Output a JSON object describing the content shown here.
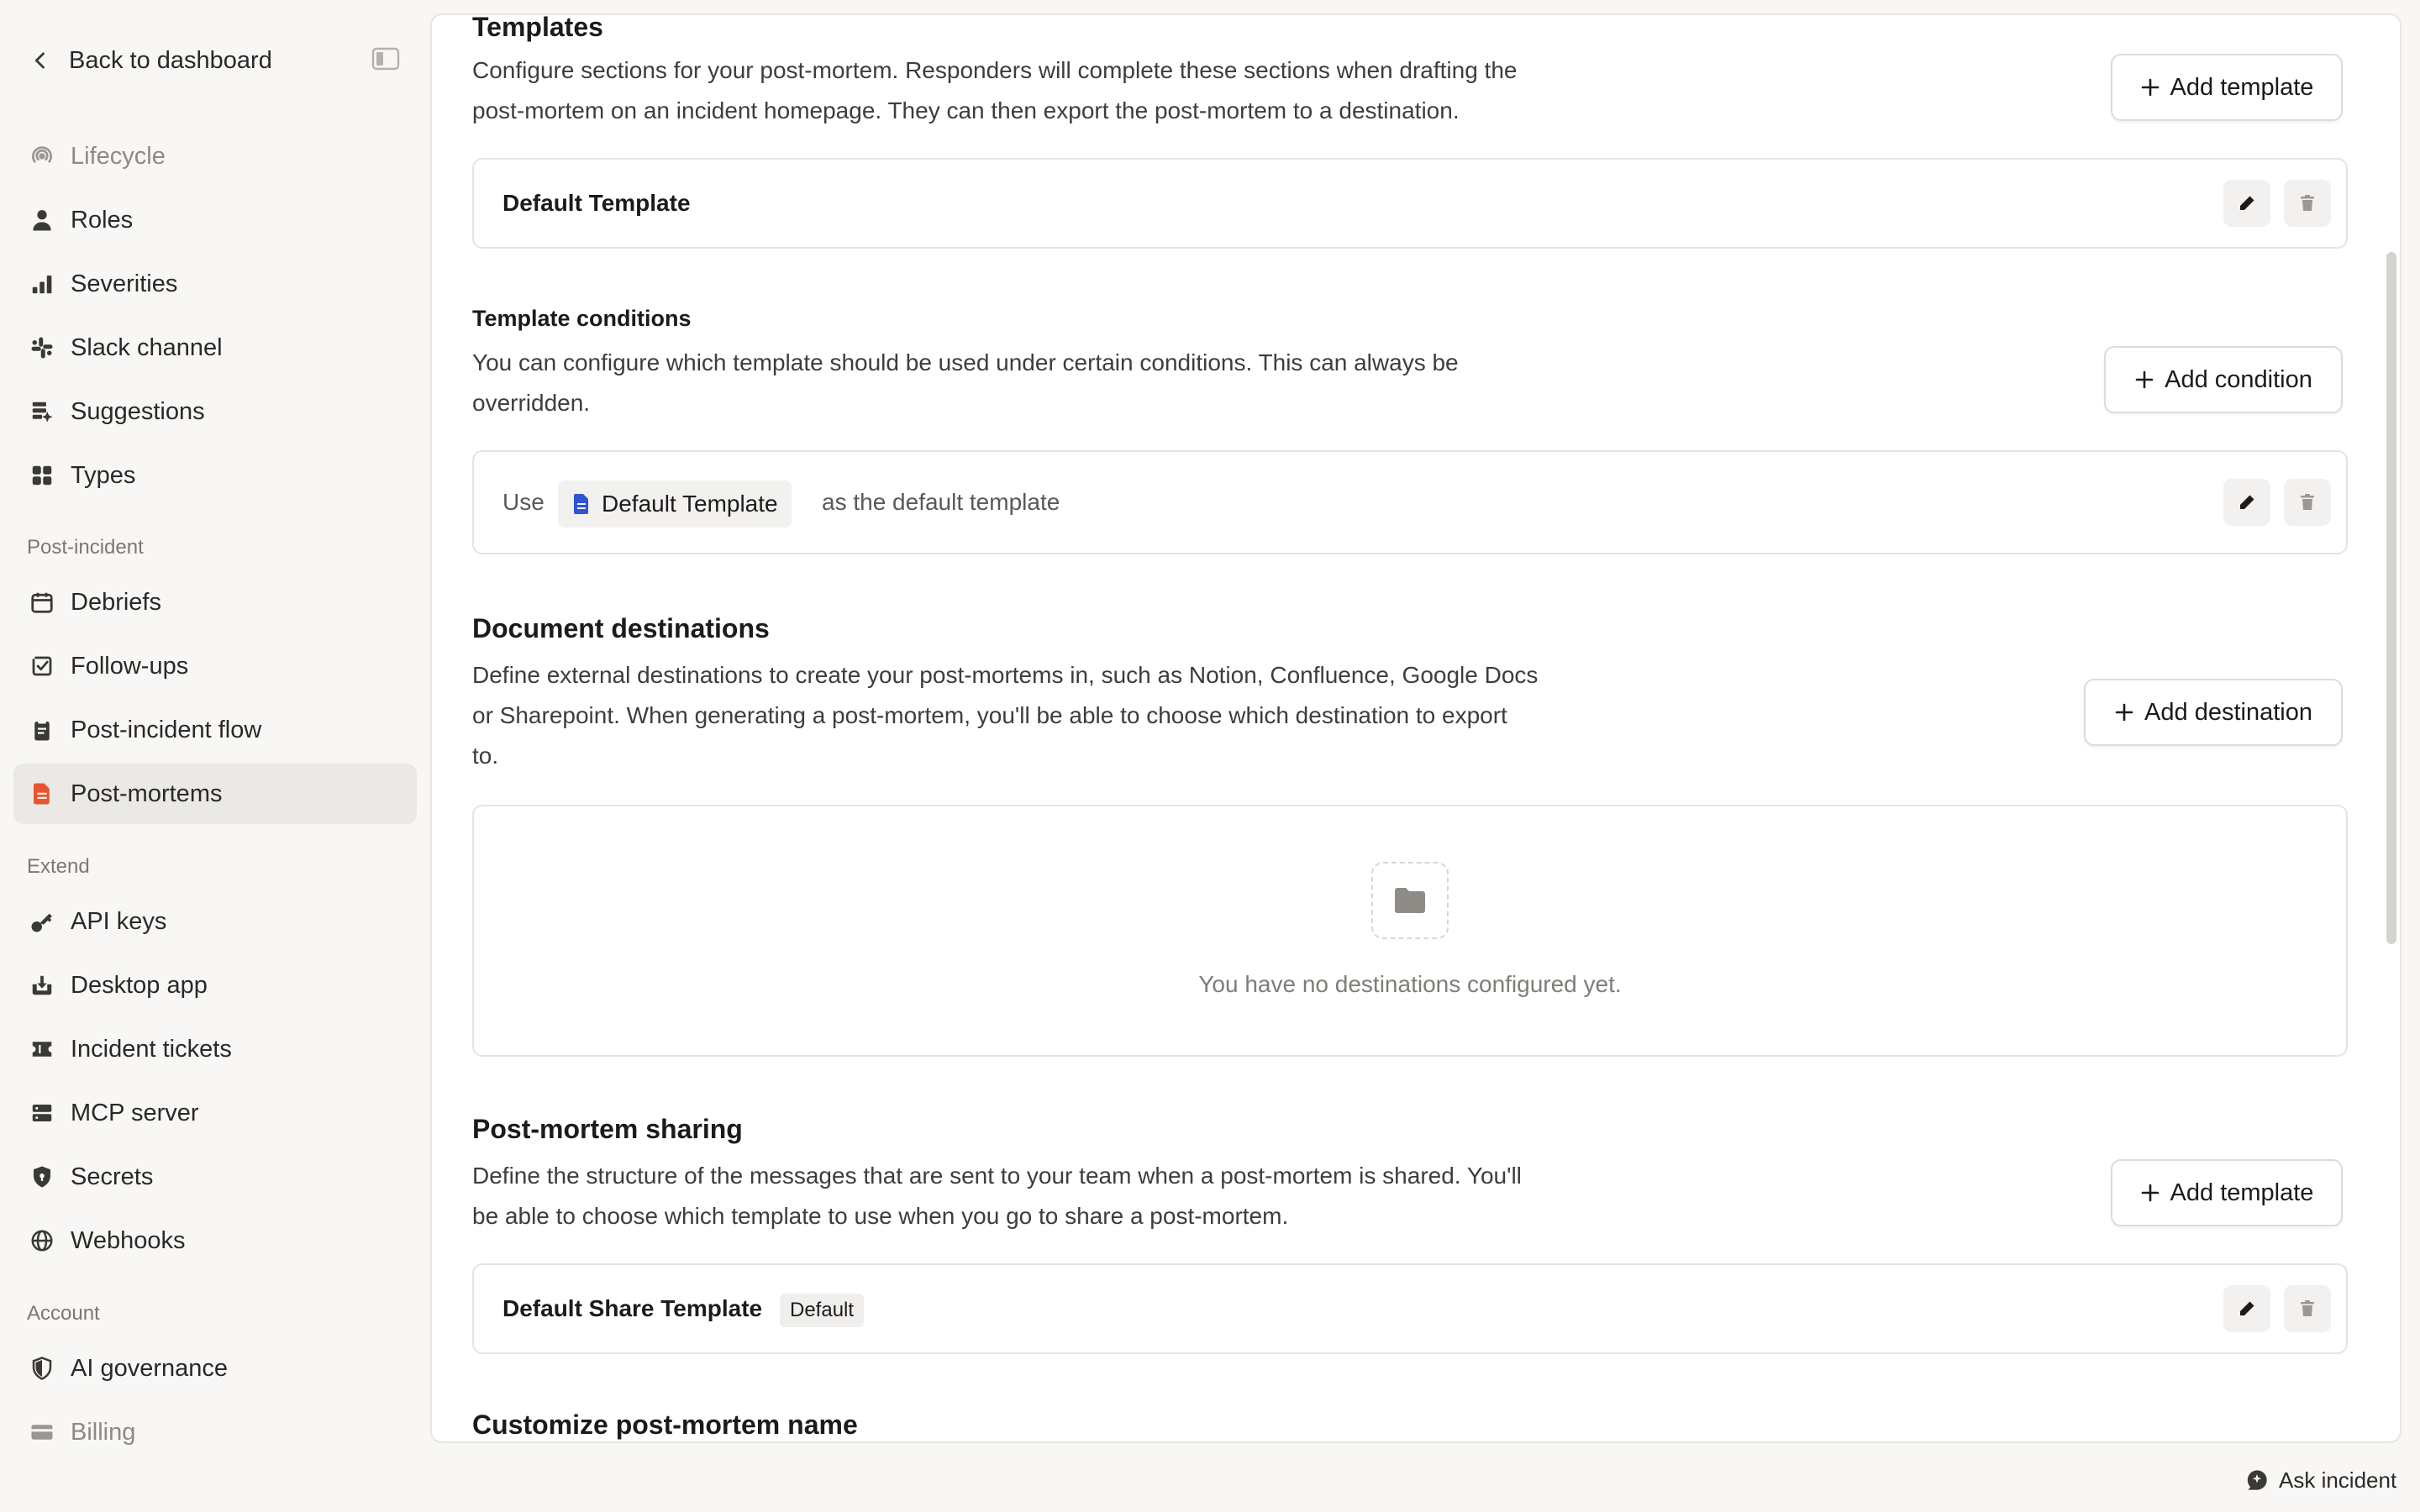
{
  "sidebar": {
    "back_label": "Back to dashboard",
    "items_top": [
      {
        "label": "Lifecycle",
        "icon": "lifecycle-icon",
        "muted": true
      },
      {
        "label": "Roles",
        "icon": "person-icon"
      },
      {
        "label": "Severities",
        "icon": "bars-icon"
      },
      {
        "label": "Slack channel",
        "icon": "slack-icon"
      },
      {
        "label": "Suggestions",
        "icon": "suggestions-icon"
      },
      {
        "label": "Types",
        "icon": "grid-icon"
      }
    ],
    "post_incident_label": "Post-incident",
    "items_post": [
      {
        "label": "Debriefs",
        "icon": "calendar-icon"
      },
      {
        "label": "Follow-ups",
        "icon": "check-square-icon"
      },
      {
        "label": "Post-incident flow",
        "icon": "clipboard-icon"
      },
      {
        "label": "Post-mortems",
        "icon": "document-icon",
        "active": true
      }
    ],
    "extend_label": "Extend",
    "items_extend": [
      {
        "label": "API keys",
        "icon": "key-icon"
      },
      {
        "label": "Desktop app",
        "icon": "download-icon"
      },
      {
        "label": "Incident tickets",
        "icon": "ticket-icon"
      },
      {
        "label": "MCP server",
        "icon": "server-icon"
      },
      {
        "label": "Secrets",
        "icon": "shield-lock-icon"
      },
      {
        "label": "Webhooks",
        "icon": "globe-icon"
      }
    ],
    "account_label": "Account",
    "items_account": [
      {
        "label": "AI governance",
        "icon": "shield-half-icon"
      },
      {
        "label": "Billing",
        "icon": "card-icon",
        "muted": true
      }
    ]
  },
  "templates": {
    "title": "Templates",
    "desc_line1": "Configure sections for your post-mortem. Responders will complete these sections when drafting the",
    "desc_line2": "post-mortem on an incident homepage. They can then export the post-mortem to a destination.",
    "add_label": "Add template",
    "row_label": "Default Template"
  },
  "conditions": {
    "title": "Template conditions",
    "desc_line1": "You can configure which template should be used under certain conditions. This can always be",
    "desc_line2": "overridden.",
    "add_label": "Add condition",
    "use_label": "Use",
    "pill_label": "Default Template",
    "suffix_label": "as the default template"
  },
  "destinations": {
    "title": "Document destinations",
    "desc_line1": "Define external destinations to create your post-mortems in, such as Notion, Confluence, Google Docs",
    "desc_line2": "or Sharepoint. When generating a post-mortem, you'll be able to choose which destination to export",
    "desc_line3": "to.",
    "add_label": "Add destination",
    "empty_text": "You have no destinations configured yet."
  },
  "sharing": {
    "title": "Post-mortem sharing",
    "desc_line1": "Define the structure of the messages that are sent to your team when a post-mortem is shared. You'll",
    "desc_line2": "be able to choose which template to use when you go to share a post-mortem.",
    "add_label": "Add template",
    "row_label": "Default Share Template",
    "badge": "Default"
  },
  "customize": {
    "title": "Customize post-mortem name"
  },
  "ask": {
    "label": "Ask incident"
  },
  "colors": {
    "accent_active_icon": "#e8542f",
    "pill_icon": "#2f54d6"
  }
}
